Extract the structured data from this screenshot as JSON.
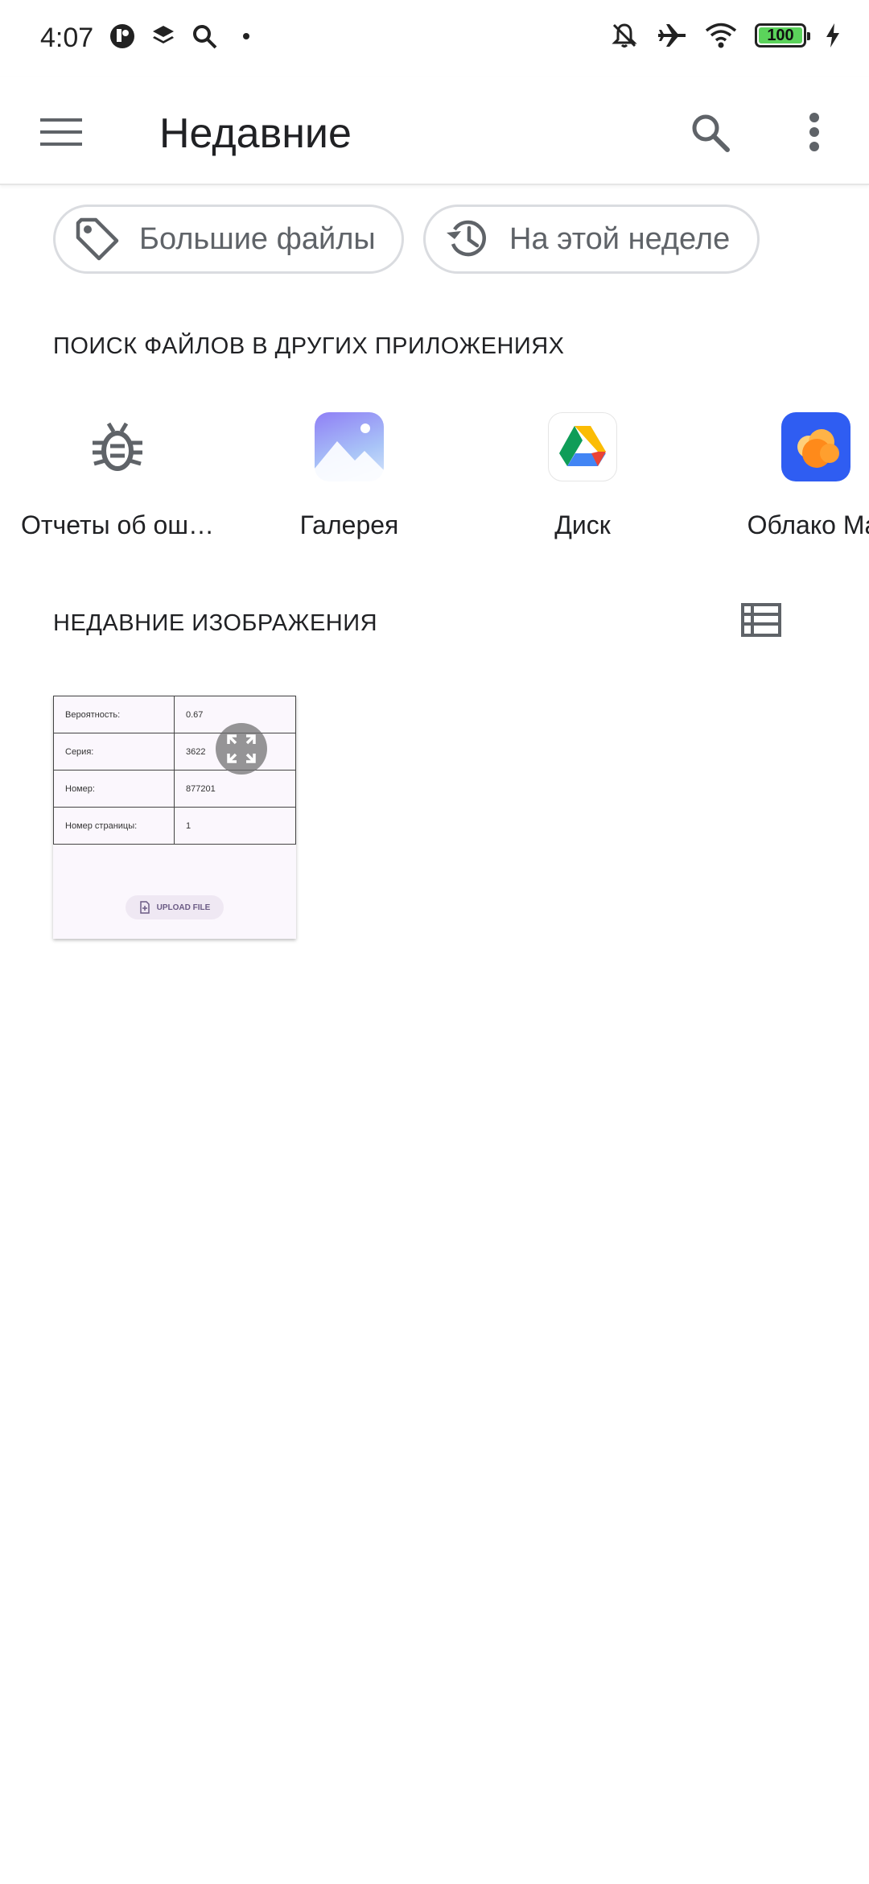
{
  "status_bar": {
    "time": "4:07",
    "battery": "100",
    "icons": [
      "app-icon",
      "layers-icon",
      "search-icon",
      "dot-icon",
      "bell-off-icon",
      "airplane-icon",
      "wifi-icon",
      "battery-icon",
      "charging-icon"
    ]
  },
  "appbar": {
    "title": "Недавние",
    "menu_icon": "hamburger-menu-icon",
    "search_icon": "search-icon",
    "more_icon": "more-vert-icon"
  },
  "chips": [
    {
      "label": "Большие файлы",
      "icon": "tag-icon"
    },
    {
      "label": "На этой неделе",
      "icon": "history-icon"
    }
  ],
  "sections": {
    "other_apps_title": "ПОИСК ФАЙЛОВ В ДРУГИХ ПРИЛОЖЕНИЯХ",
    "recent_images_title": "НЕДАВНИЕ ИЗОБРАЖЕНИЯ"
  },
  "apps": [
    {
      "name": "Отчеты об ош…",
      "icon": "bug-icon"
    },
    {
      "name": "Галерея",
      "icon": "gallery-icon"
    },
    {
      "name": "Диск",
      "icon": "drive-icon"
    },
    {
      "name": "Облако Mai",
      "icon": "cloud-icon"
    }
  ],
  "recent_image": {
    "rows": [
      {
        "label": "Вероятность:",
        "value": "0.67"
      },
      {
        "label": "Серия:",
        "value": "3622"
      },
      {
        "label": "Номер:",
        "value": "877201"
      },
      {
        "label": "Номер страницы:",
        "value": "1"
      }
    ],
    "upload_label": "UPLOAD FILE"
  },
  "colors": {
    "battery_fill": "#5bd35b",
    "gallery_gradient_top": "#8a7cf7",
    "cloud_bg": "#2f5df2",
    "cloud_orange": "#ff8a1a"
  }
}
